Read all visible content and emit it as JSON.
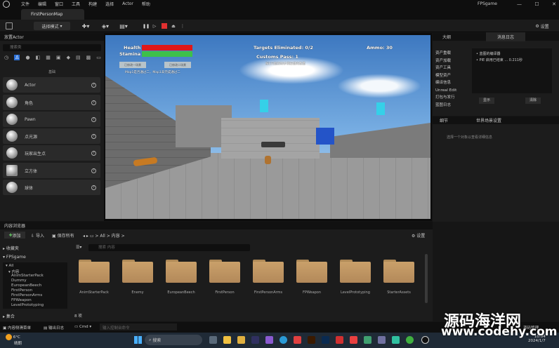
{
  "menu": {
    "items": [
      "文件",
      "编辑",
      "窗口",
      "工具",
      "构建",
      "选择",
      "Actor",
      "帮助"
    ]
  },
  "tab": {
    "title": "FirstPersonMap"
  },
  "project": {
    "name": "FPSgame"
  },
  "toolbar": {
    "mode": "选择模式",
    "settings": "设置"
  },
  "place_actors": {
    "title": "放置Actor",
    "search_placeholder": "搜索类",
    "category": "基础",
    "items": [
      "Actor",
      "角色",
      "Pawn",
      "点光源",
      "玩家出生点",
      "立方体",
      "球体"
    ]
  },
  "hud": {
    "health": "Health",
    "stamina": "Stamina",
    "targets": "Targets Eliminated: 0/2",
    "customs": "Customs Pass: 1",
    "ammo": "Ammo: 30",
    "btn1": "已修改一场景",
    "btn2": "已修改二场景",
    "hint1": "Map1是否通过二，Map1未完成通过二",
    "hint2": "按E只能控制手柄按键的数量"
  },
  "outliner": {
    "tab1": "大纲",
    "tab2": "消息日志",
    "rows": [
      "资产重载",
      "资产加载",
      "资产工具",
      "模型资产",
      "编译信息",
      "Unreal Edit",
      "打包与发行",
      "蓝图日志"
    ],
    "msg1": "蓝图的编译器",
    "msg2": "PIE 启用已结束 ... 0.211秒",
    "filter": "显示",
    "clear": "清除"
  },
  "details": {
    "tab1": "细节",
    "tab2": "世界场景设置",
    "empty": "选择一个对象以查看详细信息"
  },
  "content": {
    "title": "内容浏览器",
    "add": "添加",
    "import": "导入",
    "saveall": "保存所有",
    "path_all": "All",
    "path_content": "内容",
    "search_placeholder": "搜索 内容",
    "settings": "设置",
    "favorites": "收藏夹",
    "project": "FPSgame",
    "tree": [
      "All",
      "内容",
      "AnimStarterPack",
      "Dummy",
      "EuropeanBeech",
      "FirstPerson",
      "FirstPersonArms",
      "FPWeapon",
      "LevelPrototyping"
    ],
    "collections": "集合",
    "count": "8 项",
    "folders": [
      "AnimStarterPack",
      "Enemy",
      "EuropeanBeech",
      "FirstPerson",
      "FirstPersonArms",
      "FPWeapon",
      "LevelPrototyping",
      "StarterAssets"
    ]
  },
  "status": {
    "drawer": "内容侧滑菜单",
    "log": "输出日志",
    "cmd": "Cmd",
    "cmd_placeholder": "输入控制台命令",
    "source": "源码管理"
  },
  "taskbar": {
    "weather": "6°C",
    "weather_sub": "晴朗",
    "search": "搜索",
    "time": "10:04",
    "date": "2024/1/7"
  },
  "watermark": {
    "cn": "源码海洋网",
    "url": "www.codehy.com"
  }
}
